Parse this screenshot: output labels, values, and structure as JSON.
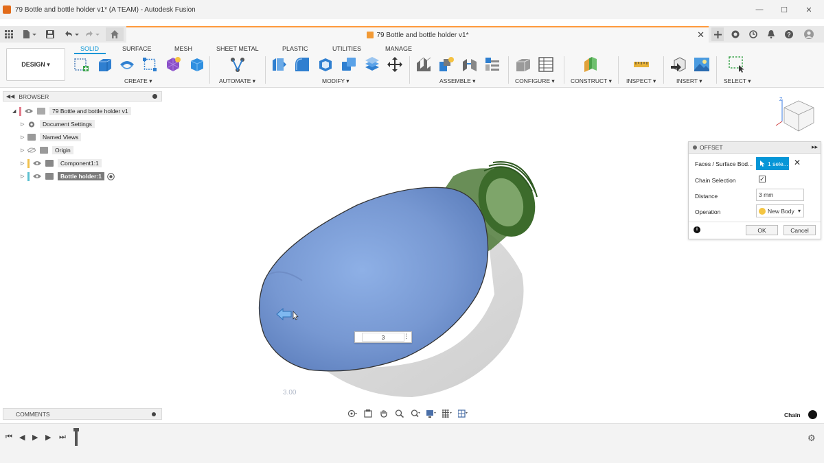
{
  "window": {
    "title": "79 Bottle and bottle holder v1* (A TEAM) - Autodesk Fusion",
    "minimize": "—",
    "maximize": "☐",
    "close": "✕"
  },
  "doc_tab": {
    "label": "79 Bottle and bottle holder v1*"
  },
  "ribbon": {
    "workspace": "DESIGN ▾",
    "tabs": [
      "SOLID",
      "SURFACE",
      "MESH",
      "SHEET METAL",
      "PLASTIC",
      "UTILITIES",
      "MANAGE"
    ],
    "groups": [
      "CREATE ▾",
      "AUTOMATE ▾",
      "MODIFY ▾",
      "ASSEMBLE ▾",
      "CONFIGURE ▾",
      "CONSTRUCT ▾",
      "INSPECT ▾",
      "INSERT ▾",
      "SELECT ▾"
    ]
  },
  "browser": {
    "header": "BROWSER",
    "items": [
      {
        "label": "79 Bottle and bottle holder v1"
      },
      {
        "label": "Document Settings"
      },
      {
        "label": "Named Views"
      },
      {
        "label": "Origin"
      },
      {
        "label": "Component1:1"
      },
      {
        "label": "Bottle holder:1"
      }
    ]
  },
  "comments": {
    "label": "COMMENTS"
  },
  "offset_dialog": {
    "title": "OFFSET",
    "faces_label": "Faces / Surface Bod...",
    "faces_value": "1 sele...",
    "chain_label": "Chain Selection",
    "chain_checked": "✓",
    "distance_label": "Distance",
    "distance_value": "3 mm",
    "operation_label": "Operation",
    "operation_value": "New Body",
    "ok": "OK",
    "cancel": "Cancel"
  },
  "canvas": {
    "dimension_label": "3.00",
    "input_value": "3"
  },
  "status": {
    "chain": "Chain"
  },
  "colors": {
    "accent": "#0696d7",
    "selected_face": "#7f9fd6",
    "bottle_green": "#3c6b2b"
  }
}
